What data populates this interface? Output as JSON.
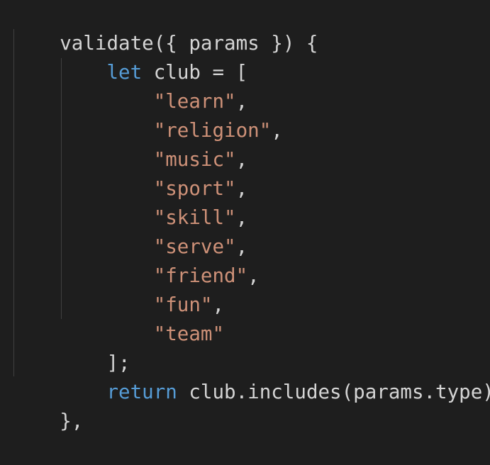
{
  "code": {
    "line1": {
      "fn": "validate",
      "open": "({ ",
      "param": "params",
      "close": " }) {"
    },
    "line2": {
      "indent": "    ",
      "keyword": "let",
      "space": " ",
      "var": "club",
      "op": " = ["
    },
    "strings": [
      {
        "indent": "        ",
        "text": "\"learn\"",
        "sep": ","
      },
      {
        "indent": "        ",
        "text": "\"religion\"",
        "sep": ","
      },
      {
        "indent": "        ",
        "text": "\"music\"",
        "sep": ","
      },
      {
        "indent": "        ",
        "text": "\"sport\"",
        "sep": ","
      },
      {
        "indent": "        ",
        "text": "\"skill\"",
        "sep": ","
      },
      {
        "indent": "        ",
        "text": "\"serve\"",
        "sep": ","
      },
      {
        "indent": "        ",
        "text": "\"friend\"",
        "sep": ","
      },
      {
        "indent": "        ",
        "text": "\"fun\"",
        "sep": ","
      },
      {
        "indent": "        ",
        "text": "\"team\"",
        "sep": ""
      }
    ],
    "line12": {
      "indent": "    ",
      "text": "];"
    },
    "line13": {
      "indent": "    ",
      "keyword": "return",
      "space": " ",
      "rest": "club.includes(params.type);"
    },
    "line14": {
      "text": "},"
    }
  },
  "colors": {
    "background": "#1e1e1e",
    "keyword": "#569cd6",
    "string": "#ce9178",
    "text": "#d4d4d4",
    "indent_guide": "#404040"
  }
}
